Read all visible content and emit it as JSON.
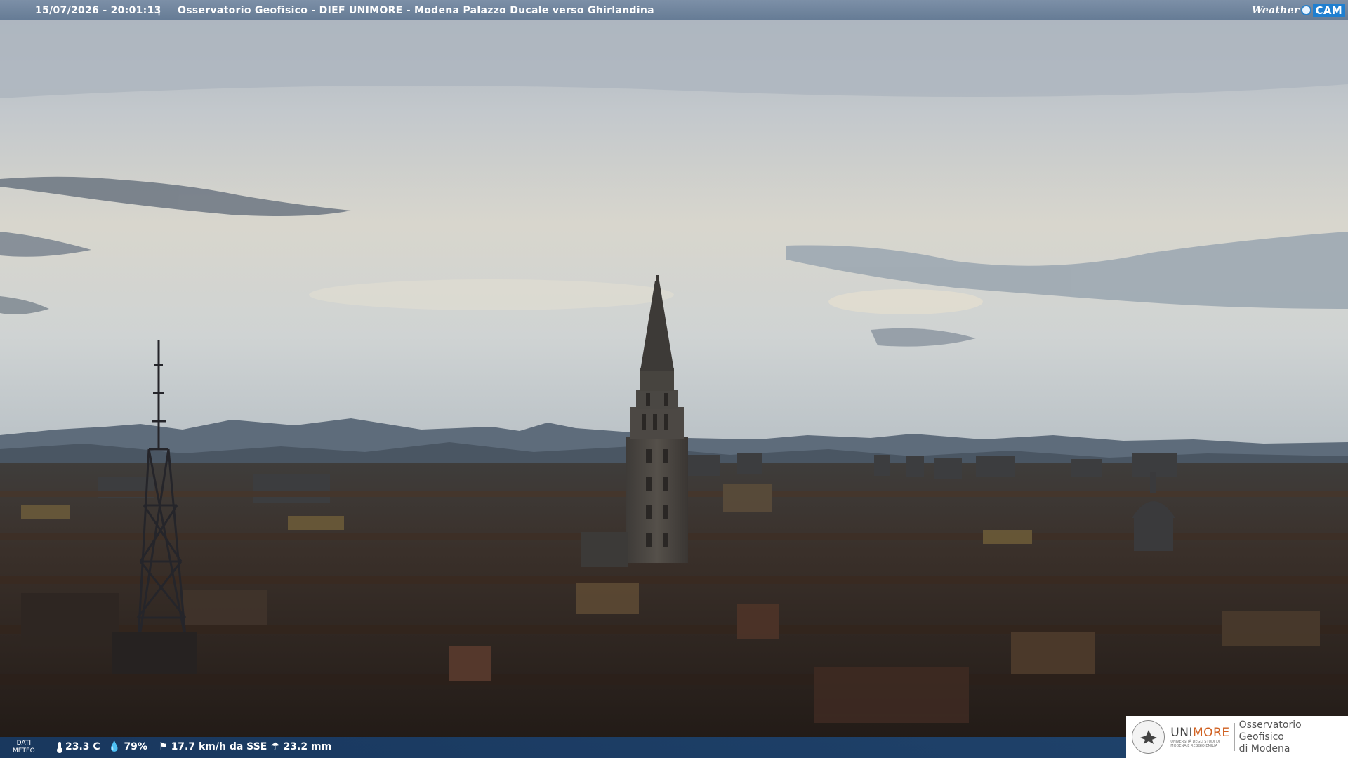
{
  "overlay": {
    "datetime": "15/07/2026 - 20:01:13",
    "separator": "|",
    "camera_title": "Osservatorio Geofisico - DIEF UNIMORE - Modena Palazzo Ducale verso Ghirlandina",
    "logo": {
      "weather": "Weather",
      "cam": "CAM"
    }
  },
  "weather_bar": {
    "label_line1": "DATI",
    "label_line2": "METEO",
    "temperature": "23.3 C",
    "humidity": "79%",
    "wind": "17.7 km/h da SSE",
    "rain": "23.2 mm"
  },
  "institution": {
    "name_prefix": "UNI",
    "name_suffix": "MORE",
    "subtitle": "UNIVERSITÀ DEGLI STUDI DI MODENA E REGGIO EMILIA",
    "observatory_line1": "Osservatorio Geofisico",
    "observatory_line2": "di Modena"
  },
  "colors": {
    "sky_top": "#b4bcc6",
    "sky_horizon": "#dcd8cc",
    "mountains": "#5d6b7a",
    "roofs": "#2a211c",
    "overlay_bar": "#6a84a2",
    "weather_bar": "#1d4a7c"
  }
}
